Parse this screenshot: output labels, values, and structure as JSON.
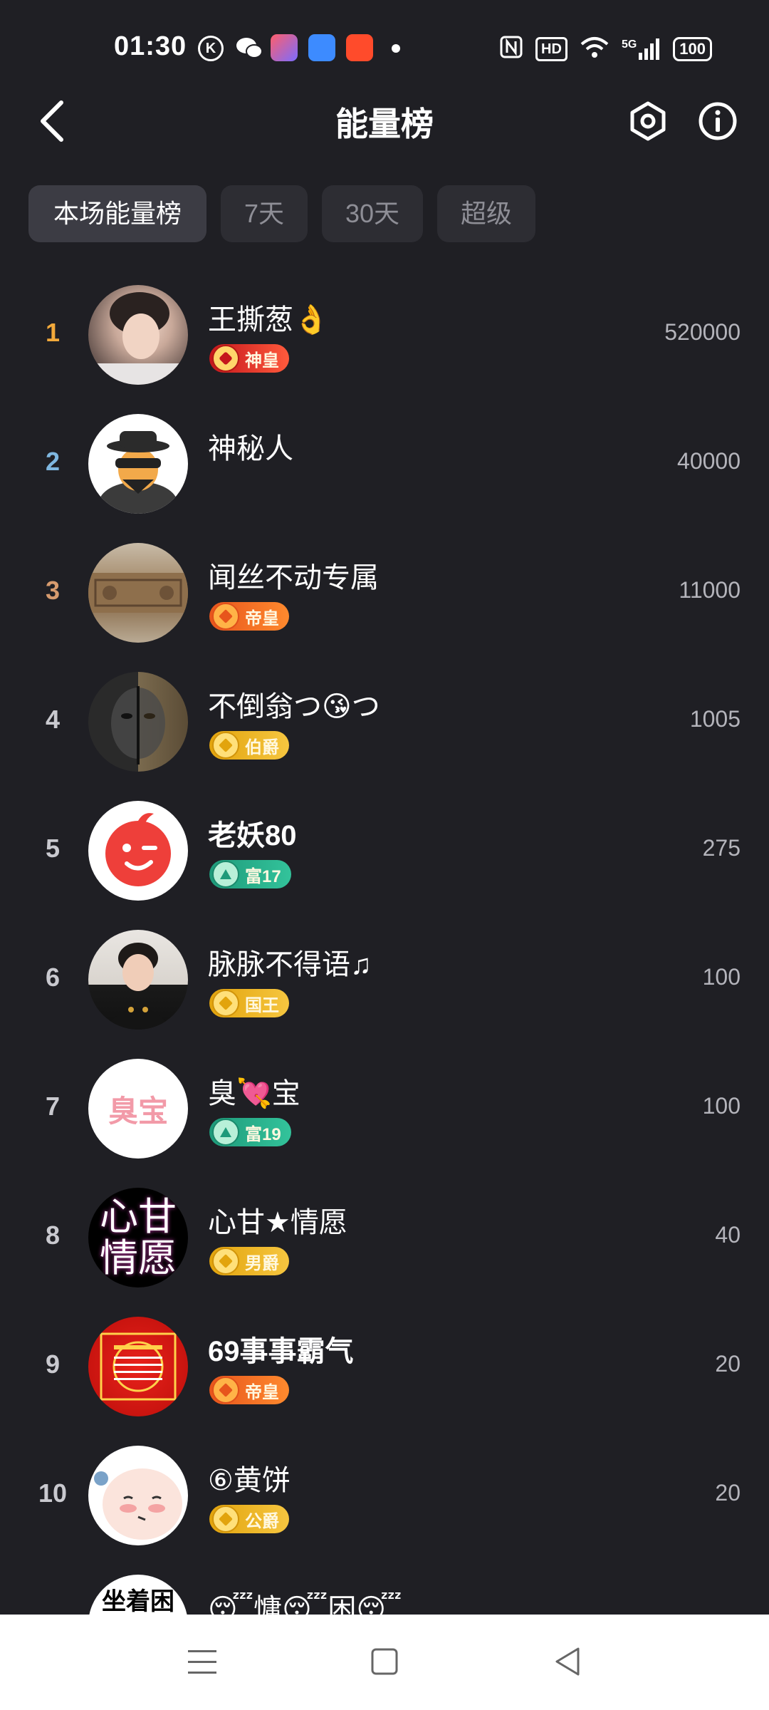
{
  "status_bar": {
    "time": "01:30",
    "k_label": "K",
    "hd_label": "HD",
    "signal_label": "5G",
    "battery": "100"
  },
  "header": {
    "title": "能量榜"
  },
  "tabs": [
    {
      "label": "本场能量榜",
      "active": true
    },
    {
      "label": "7天",
      "active": false
    },
    {
      "label": "30天",
      "active": false
    },
    {
      "label": "超级",
      "active": false
    }
  ],
  "ranking": [
    {
      "rank": "1",
      "name": "王撕葱👌",
      "badge": "神皇",
      "badge_type": "shenhuang",
      "score": "520000",
      "rank_color": "#f2a93b"
    },
    {
      "rank": "2",
      "name": "神秘人",
      "badge": "",
      "badge_type": "none",
      "score": "40000",
      "rank_color": "#7fb7e0"
    },
    {
      "rank": "3",
      "name": "闻丝不动专属",
      "badge": "帝皇",
      "badge_type": "dihuang",
      "score": "11000",
      "rank_color": "#d79b6e"
    },
    {
      "rank": "4",
      "name": "不倒翁つ😘つ",
      "badge": "伯爵",
      "badge_type": "gold",
      "score": "1005",
      "rank_color": "#c9c9cf"
    },
    {
      "rank": "5",
      "name": "老妖80",
      "badge": "富17",
      "badge_type": "green",
      "score": "275",
      "rank_color": "#c9c9cf"
    },
    {
      "rank": "6",
      "name": "脉脉不得语♫",
      "badge": "国王",
      "badge_type": "gold",
      "score": "100",
      "rank_color": "#c9c9cf"
    },
    {
      "rank": "7",
      "name": "臭💘宝",
      "badge": "富19",
      "badge_type": "green",
      "score": "100",
      "rank_color": "#c9c9cf"
    },
    {
      "rank": "8",
      "name": "心甘★情愿",
      "badge": "男爵",
      "badge_type": "gold",
      "score": "40",
      "rank_color": "#c9c9cf"
    },
    {
      "rank": "9",
      "name": "69事事霸气",
      "badge": "帝皇",
      "badge_type": "dihuang",
      "score": "20",
      "rank_color": "#c9c9cf"
    },
    {
      "rank": "10",
      "name": "⑥黄饼",
      "badge": "公爵",
      "badge_type": "gold",
      "score": "20",
      "rank_color": "#c9c9cf"
    },
    {
      "rank": "",
      "name": "😴慵😴困😴",
      "badge": "",
      "badge_type": "none",
      "score": "",
      "rank_color": "#c9c9cf"
    }
  ],
  "avatar_texts": {
    "row8_line1": "心甘",
    "row8_line2": "情愿",
    "row7": "臭宝",
    "row11": "坐着困"
  },
  "icons": [
    "back-icon",
    "settings-hexagon-icon",
    "info-icon",
    "menu-icon",
    "home-icon",
    "back-triangle-icon"
  ],
  "colors": {
    "background": "#1f1f24",
    "tab_bg": "#2d2d33",
    "tab_active_bg": "#3c3c44",
    "navbar": "#ffffff"
  }
}
